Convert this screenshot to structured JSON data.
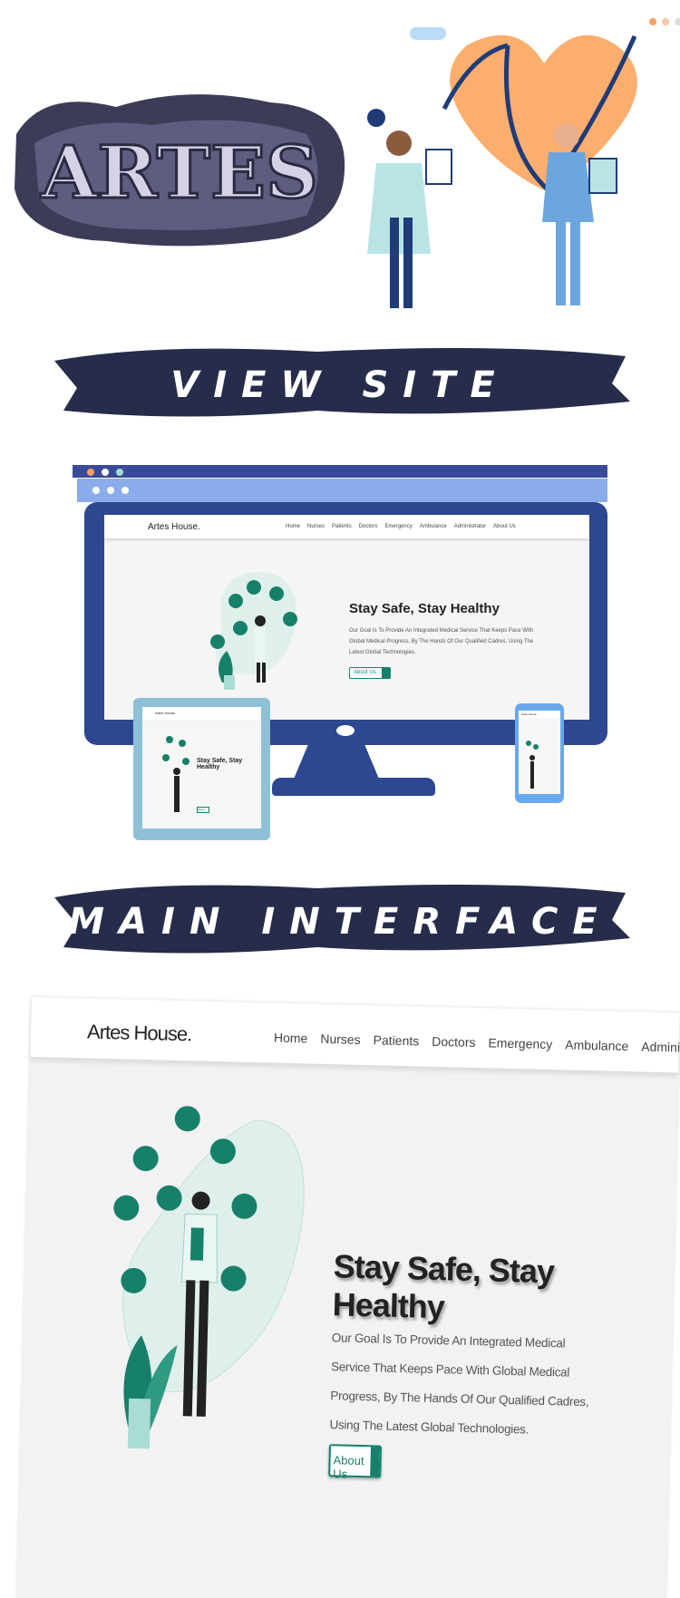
{
  "hero": {
    "logo_text": "ARTES",
    "logo_icon": "artes-logo-icon",
    "illustration": "doctors-heart-stethoscope-illustration"
  },
  "banners": {
    "view_site": "VIEW SITE",
    "main_interface": "MAIN INTERFACE"
  },
  "site": {
    "brand": "Artes House.",
    "nav": [
      "Home",
      "Nurses",
      "Patients",
      "Doctors",
      "Emergency",
      "Ambulance",
      "Administrator",
      "About Us"
    ],
    "headline": "Stay Safe, Stay Healthy",
    "body": "Our Goal Is To Provide An Integrated Medical Service That Keeps Pace With Global Medical Progress, By The Hands Of Our Qualified Cadres, Using The Latest Global Technologies.",
    "cta": "About Us",
    "illustration": "doctor-medical-icons-illustration"
  },
  "colors": {
    "accent": "#17806a",
    "navy": "#2d4890",
    "banner": "#262c4a",
    "heart": "#fbae6e"
  }
}
